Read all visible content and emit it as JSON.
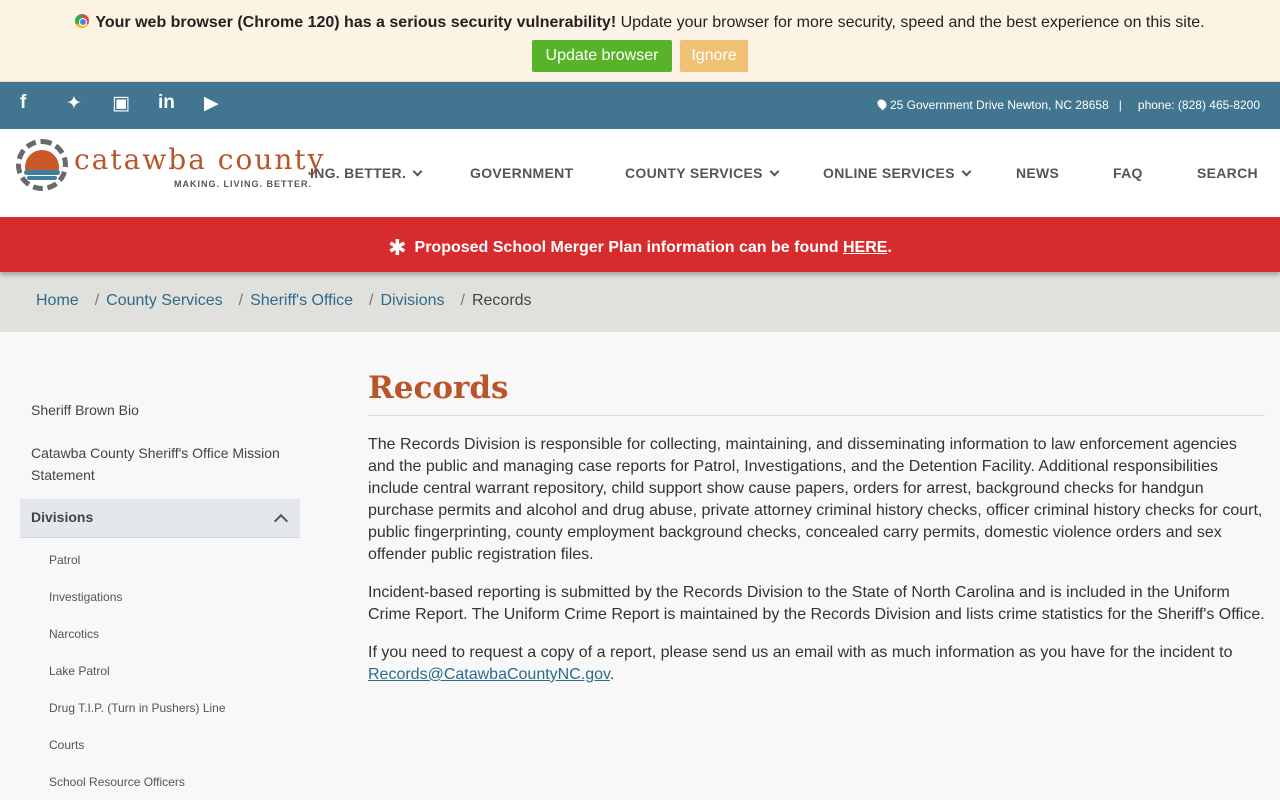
{
  "warning": {
    "bold": "Your web browser (Chrome 120) has a serious security vulnerability!",
    "rest": " Update your browser for more security, speed and the best experience on this site.",
    "update_label": "Update browser",
    "ignore_label": "Ignore"
  },
  "social": {
    "icons": [
      "facebook-icon",
      "twitter-icon",
      "instagram-icon",
      "linkedin-icon",
      "youtube-icon"
    ],
    "address": "25 Government Drive Newton, NC 28658",
    "separator": "|",
    "phone": "phone: (828) 465-8200"
  },
  "logo": {
    "name": "catawba county",
    "tagline": "MAKING. LIVING. BETTER."
  },
  "nav": [
    {
      "label": "ING. BETTER."
    },
    {
      "label": "GOVERNMENT"
    },
    {
      "label": "COUNTY SERVICES"
    },
    {
      "label": "ONLINE SERVICES"
    },
    {
      "label": "NEWS"
    },
    {
      "label": "FAQ"
    },
    {
      "label": "SEARCH"
    }
  ],
  "alert": {
    "text": "Proposed School Merger Plan information can be found ",
    "link": "HERE",
    "end": "."
  },
  "breadcrumb": {
    "home": "Home",
    "county_services": "County Services",
    "sheriffs_office": "Sheriff's Office",
    "divisions": "Divisions",
    "current": "Records",
    "separator": "/"
  },
  "sidebar": {
    "items": [
      "Sheriff Brown Bio",
      "Catawba County Sheriff's Office Mission Statement"
    ],
    "active": "Divisions",
    "sub_items": [
      "Patrol",
      "Investigations",
      "Narcotics",
      "Lake Patrol",
      "Drug T.I.P. (Turn in Pushers) Line",
      "Courts",
      "School Resource Officers"
    ]
  },
  "main": {
    "title": "Records",
    "p1": "The Records Division is responsible for collecting, maintaining, and disseminating information to law enforcement agencies and the public and managing case reports for Patrol, Investigations, and the Detention Facility. Additional responsibilities include central warrant repository, child support show cause papers, orders for arrest, background checks for handgun purchase permits and alcohol and drug abuse, private attorney criminal history checks, officer criminal history checks for court, public fingerprinting, county employment background checks, concealed carry permits, domestic violence orders and sex offender public registration files.",
    "p2": "Incident-based reporting is submitted by the Records Division to the State of North Carolina and is included in the Uniform Crime Report. The Uniform Crime Report is maintained by the Records Division and lists crime statistics for the Sheriff's Office.",
    "p3": "If you need to request a copy of a report, please send us an email with as much information as you have for the incident to ",
    "email": "Records@CatawbaCountyNC.gov",
    "p3_end": "."
  }
}
